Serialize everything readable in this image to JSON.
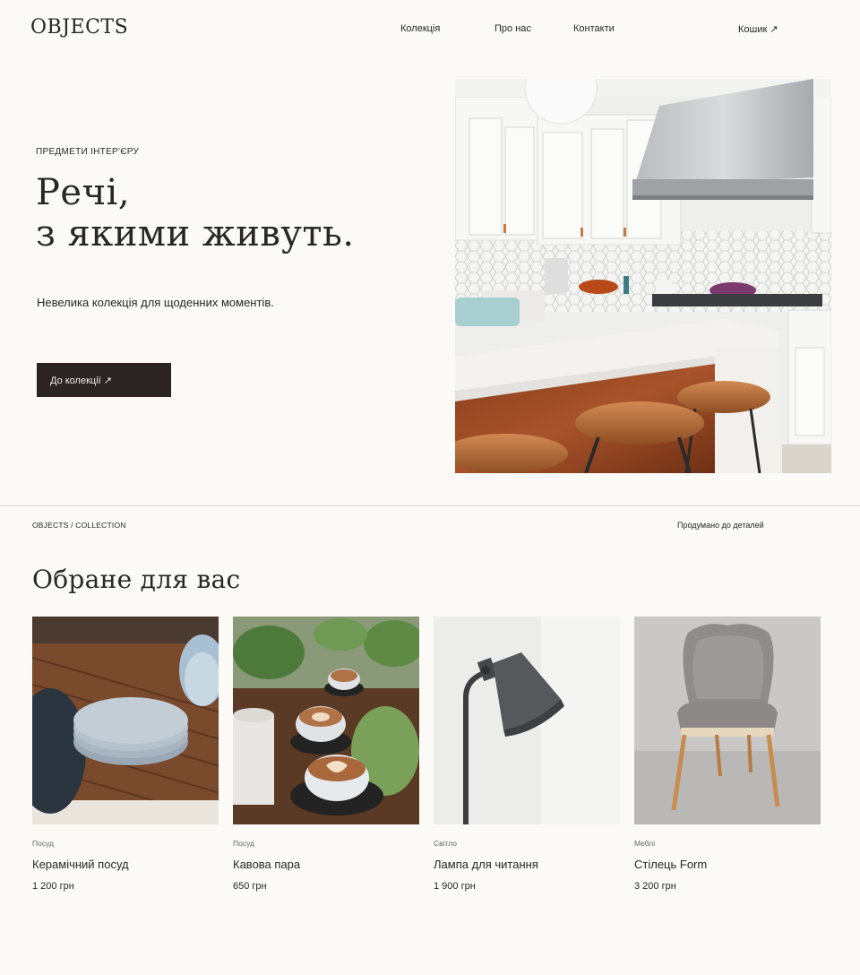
{
  "brand": {
    "logo": "OBJECTS"
  },
  "nav": {
    "items": [
      "Колекція",
      "Про нас",
      "Контакти"
    ],
    "cart": "Кошик ↗"
  },
  "hero": {
    "eyebrow": "ПРЕДМЕТИ ІНТЕР'ЄРУ",
    "title_line1": "Речі,",
    "title_line2": "з якими живуть.",
    "subtitle": "Невелика колекція для щоденних моментів.",
    "cta": "До колекції ↗"
  },
  "section": {
    "breadcrumb": "OBJECTS / COLLECTION",
    "tagline": "Продумано до деталей",
    "title": "Обране для вас"
  },
  "products": [
    {
      "category": "Посуд",
      "name": "Керамічний посуд",
      "price": "1 200 грн"
    },
    {
      "category": "Посуд",
      "name": "Кавова пара",
      "price": "650 грн"
    },
    {
      "category": "Світло",
      "name": "Лампа для читання",
      "price": "1 900 грн"
    },
    {
      "category": "Меблі",
      "name": "Стілець Form",
      "price": "3 200 грн"
    }
  ],
  "colors": {
    "background": "#fbfaf6",
    "text": "#2a2624",
    "button": "#2c2422"
  }
}
